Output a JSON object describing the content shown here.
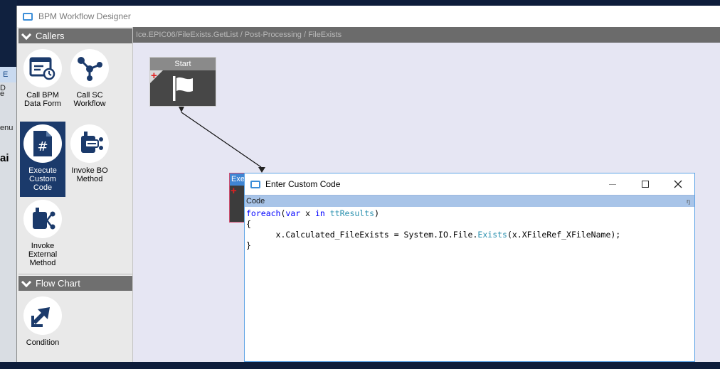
{
  "background": {
    "fragment_1": "E",
    "fragment_2": "D",
    "fragment_3": "e",
    "fragment_4": "enu",
    "fragment_5": "ai"
  },
  "window": {
    "title": "BPM Workflow Designer"
  },
  "palette": {
    "categories": [
      {
        "label": "Callers",
        "tools": [
          {
            "label": "Call BPM Data Form",
            "icon": "form-clock-icon",
            "selected": false
          },
          {
            "label": "Call SC Workflow",
            "icon": "workflow-nodes-icon",
            "selected": false
          },
          {
            "label": "Execute Custom Code",
            "icon": "code-file-icon",
            "selected": true
          },
          {
            "label": "Invoke BO Method",
            "icon": "bo-method-icon",
            "selected": false
          },
          {
            "label": "Invoke External Method",
            "icon": "external-method-icon",
            "selected": false
          }
        ]
      },
      {
        "label": "Flow Chart",
        "tools": [
          {
            "label": "Condition",
            "icon": "condition-arrow-icon",
            "selected": false
          }
        ]
      }
    ]
  },
  "canvas": {
    "breadcrumb": "Ice.EPIC06/FileExists.GetList / Post-Processing / FileExists",
    "start_node": {
      "label": "Start",
      "plus": "+"
    },
    "exec_node": {
      "label": "Exec",
      "plus": "+"
    }
  },
  "dialog": {
    "title": "Enter Custom Code",
    "code_bar_label": "Code",
    "code_bar_pin": "ŋ",
    "code": {
      "line1": {
        "kw1": "foreach",
        "p1": "(",
        "kw2": "var",
        "p2": " x ",
        "kw3": "in",
        "p3": " ",
        "tp1": "ttResults",
        "p4": ")"
      },
      "line2": "{",
      "line3": {
        "p1": "      x.Calculated_FileExists = System.IO.File.",
        "tp1": "Exists",
        "p2": "(x.XFileRef_XFileName);"
      },
      "line4": "}"
    }
  },
  "colors": {
    "selected_tool": "#1b3a6b",
    "category_header": "#6f6f6f",
    "canvas": "#e6e6f3",
    "code_keyword": "#0000ff",
    "code_type": "#2b91af",
    "accent": "#3c8ed8"
  }
}
